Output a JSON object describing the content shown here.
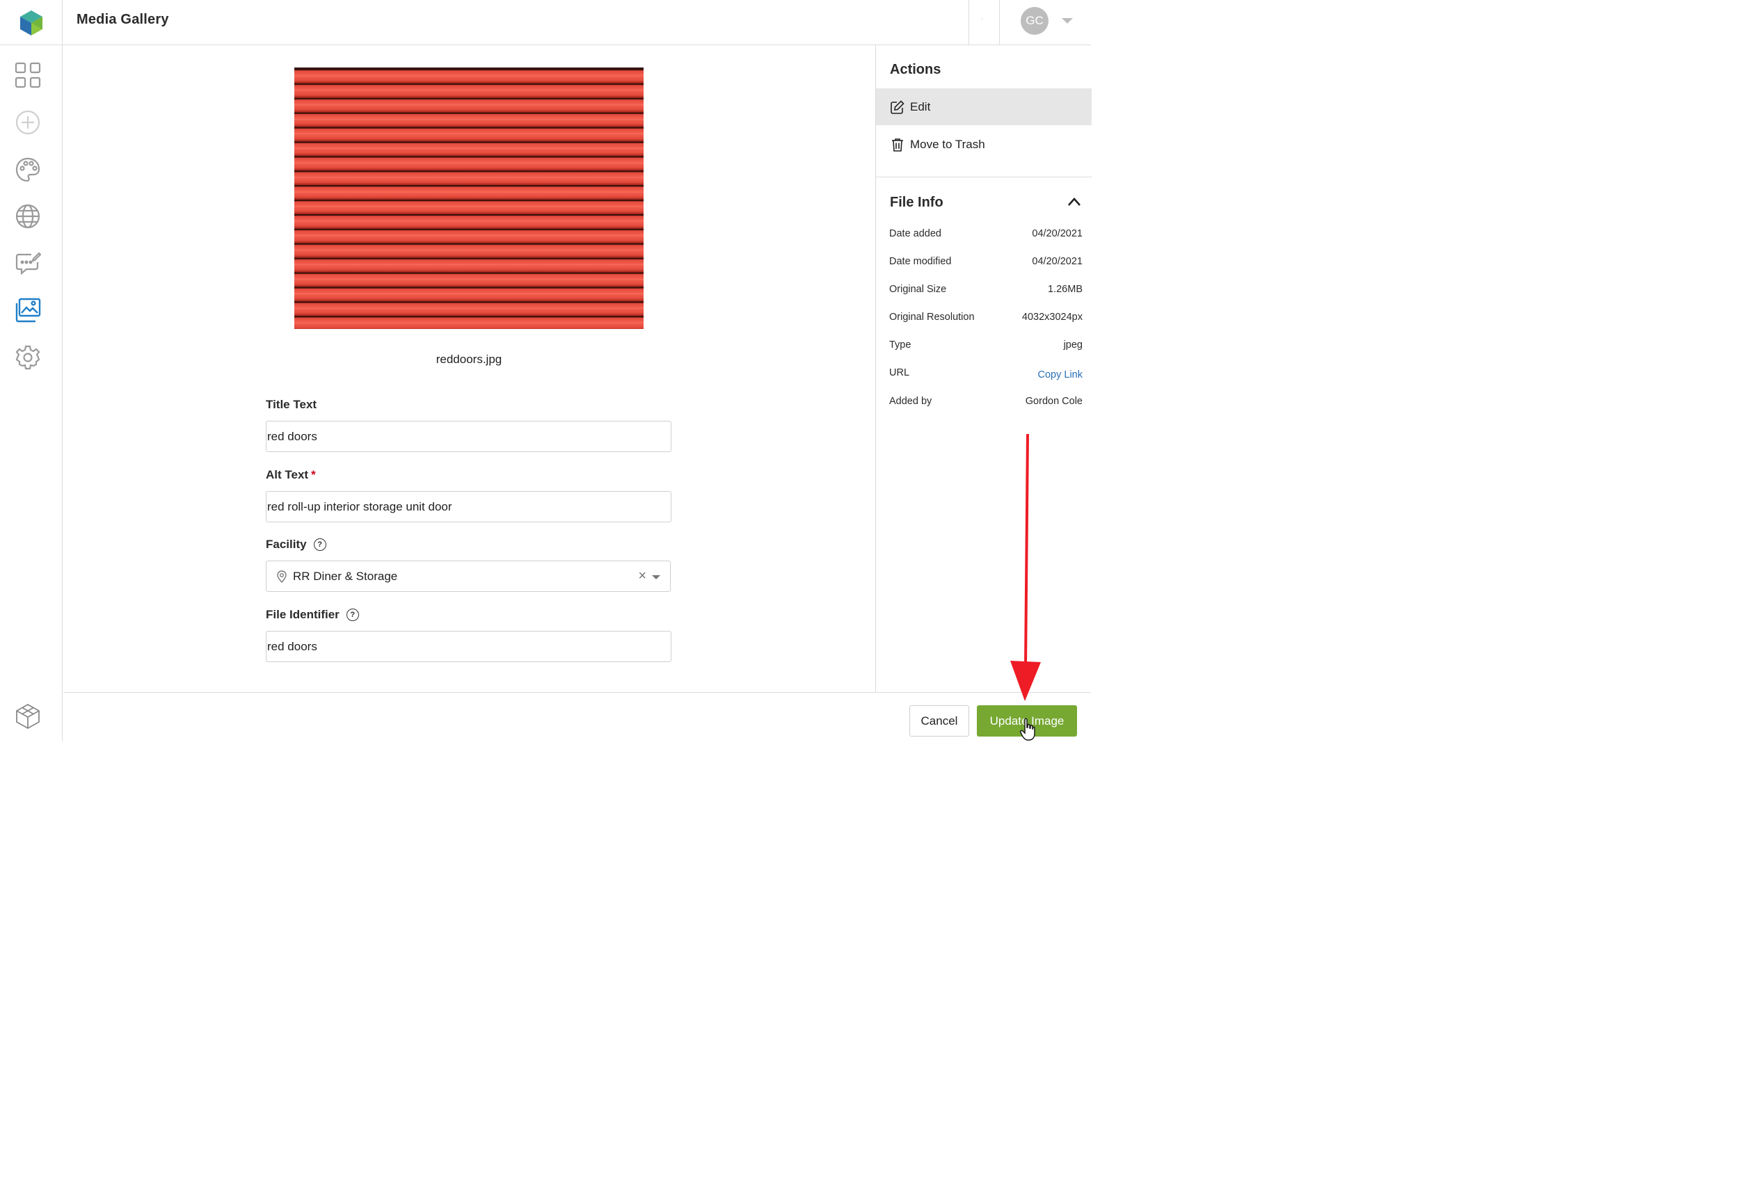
{
  "header": {
    "title": "Media Gallery",
    "dot": "·",
    "avatar_initials": "GC"
  },
  "colors": {
    "accent_green": "#76a832",
    "active_nav_blue": "#1f7fc9",
    "link_blue": "#2a6fb5",
    "required_red": "#d0021b",
    "annotation_red": "#ee1c25"
  },
  "sidenav": {
    "items": [
      {
        "icon": "dashboard-grid-icon",
        "active": false
      },
      {
        "icon": "add-circle-icon",
        "active": false
      },
      {
        "icon": "palette-icon",
        "active": false
      },
      {
        "icon": "globe-icon",
        "active": false
      },
      {
        "icon": "chat-edit-icon",
        "active": false
      },
      {
        "icon": "media-gallery-icon",
        "active": true
      },
      {
        "icon": "settings-gear-icon",
        "active": false
      }
    ],
    "bottom_icon": "cube-logo-icon"
  },
  "main": {
    "filename": "reddoors.jpg",
    "title_text": {
      "label": "Title Text",
      "value": "red doors"
    },
    "alt_text": {
      "label": "Alt Text",
      "required_mark": "*",
      "value": "red roll-up interior storage unit door"
    },
    "facility": {
      "label": "Facility",
      "help": "?",
      "value": "RR Diner & Storage",
      "clear": "×"
    },
    "file_identifier": {
      "label": "File Identifier",
      "help": "?",
      "value": "red doors"
    }
  },
  "actions": {
    "heading": "Actions",
    "items": [
      {
        "label": "Edit",
        "icon": "edit-icon",
        "active": true
      },
      {
        "label": "Move to Trash",
        "icon": "trash-icon",
        "active": false
      }
    ]
  },
  "file_info": {
    "heading": "File Info",
    "rows": [
      {
        "label": "Date added",
        "value": "04/20/2021"
      },
      {
        "label": "Date modified",
        "value": "04/20/2021"
      },
      {
        "label": "Original Size",
        "value": "1.26MB"
      },
      {
        "label": "Original Resolution",
        "value": "4032x3024px"
      },
      {
        "label": "Type",
        "value": "jpeg"
      },
      {
        "label": "URL",
        "value": "Copy Link"
      },
      {
        "label": "Added by",
        "value": "Gordon Cole"
      }
    ]
  },
  "footer": {
    "cancel_label": "Cancel",
    "update_label": "Update Image"
  }
}
